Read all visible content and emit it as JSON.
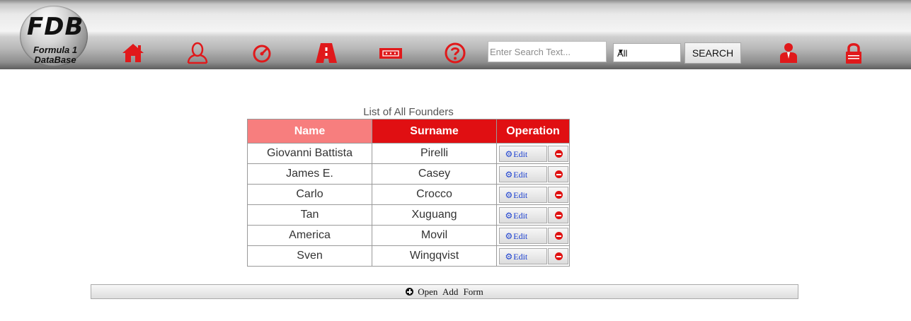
{
  "brand": {
    "mark": "FDB",
    "line1": "Formula 1",
    "line2": "DataBase"
  },
  "nav": {
    "icons": [
      {
        "name": "home-icon"
      },
      {
        "name": "user-icon"
      },
      {
        "name": "speedometer-icon"
      },
      {
        "name": "road-icon"
      },
      {
        "name": "ticket-icon"
      },
      {
        "name": "help-icon"
      },
      {
        "name": "admin-user-icon"
      },
      {
        "name": "lock-icon"
      }
    ],
    "accent_color": "#e0191b"
  },
  "search": {
    "placeholder": "Enter Search Text...",
    "value": "",
    "category_selected": "All",
    "button_label": "SEARCH"
  },
  "table": {
    "caption": "List of All Founders",
    "headers": {
      "name": "Name",
      "surname": "Surname",
      "operation": "Operation"
    },
    "edit_label": "Edit",
    "rows": [
      {
        "name": "Giovanni Battista",
        "surname": "Pirelli"
      },
      {
        "name": "James E.",
        "surname": "Casey"
      },
      {
        "name": "Carlo",
        "surname": "Crocco"
      },
      {
        "name": "Tan",
        "surname": "Xuguang"
      },
      {
        "name": "America",
        "surname": "Movil"
      },
      {
        "name": "Sven",
        "surname": "Wingqvist"
      }
    ],
    "header_colors": {
      "name": "#f77e7e",
      "other": "#e00f12"
    }
  },
  "footer": {
    "add_form_label": "Open Add Form"
  }
}
